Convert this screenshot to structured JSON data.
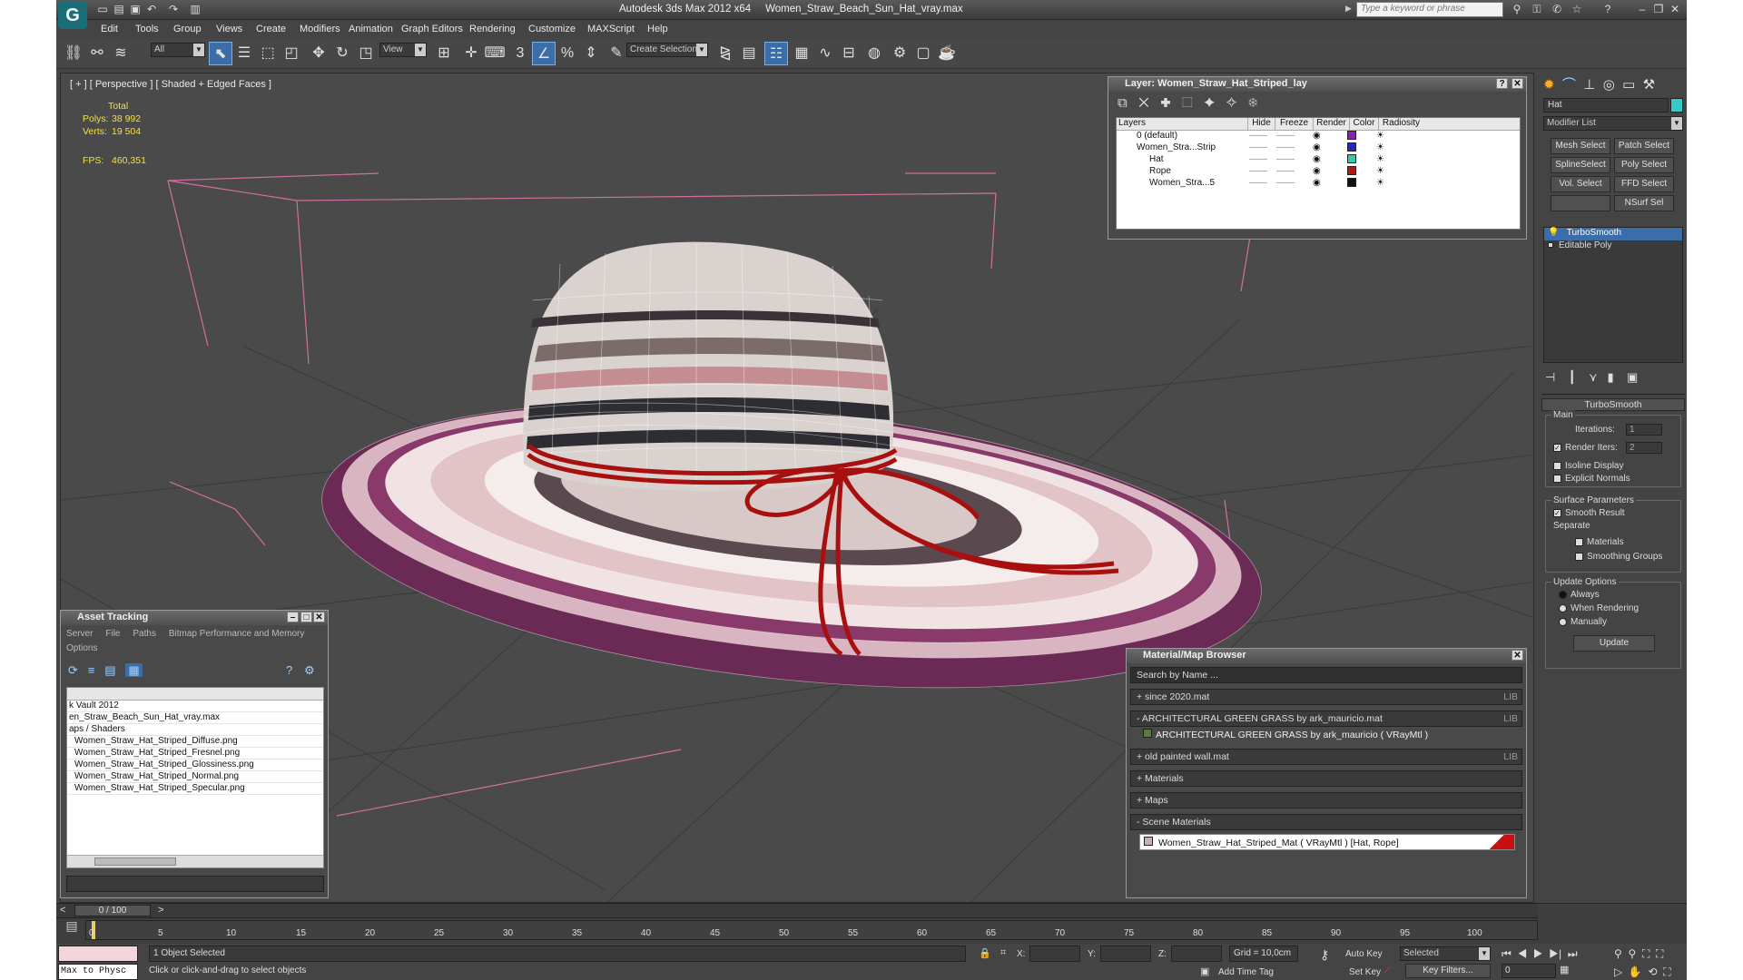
{
  "app": {
    "title": "Autodesk 3ds Max 2012 x64",
    "filename": "Women_Straw_Beach_Sun_Hat_vray.max",
    "search_placeholder": "Type a keyword or phrase"
  },
  "menus": [
    "Edit",
    "Tools",
    "Group",
    "Views",
    "Create",
    "Modifiers",
    "Animation",
    "Graph Editors",
    "Rendering",
    "Customize",
    "MAXScript",
    "Help"
  ],
  "toolbar": {
    "selection_filter": "All",
    "ref_coord": "View",
    "snap_label": "3",
    "named_selection": "Create Selection Se"
  },
  "viewport": {
    "label": "[ + ] [ Perspective ] [ Shaded + Edged Faces ]",
    "stats": {
      "total_label": "Total",
      "polys_label": "Polys:",
      "polys": "38 992",
      "verts_label": "Verts:",
      "verts": "19 504",
      "fps_label": "FPS:",
      "fps": "460,351"
    }
  },
  "layer_panel": {
    "title": "Layer: Women_Straw_Hat_Striped_lay",
    "columns": [
      "Layers",
      "Hide",
      "Freeze",
      "Render",
      "Color",
      "Radiosity"
    ],
    "rows": [
      {
        "name": "0 (default)",
        "color": "#8a1fb0"
      },
      {
        "name": "Women_Stra...Strip",
        "color": "#2525c0"
      },
      {
        "name": "Hat",
        "color": "#38c8a8"
      },
      {
        "name": "Rope",
        "color": "#b01818"
      },
      {
        "name": "Women_Stra...5",
        "color": "#111111"
      }
    ]
  },
  "asset_tracking": {
    "title": "Asset Tracking",
    "menus": [
      "Server",
      "File",
      "Paths",
      "Bitmap Performance and Memory",
      "Options"
    ],
    "items": [
      "k Vault 2012",
      "en_Straw_Beach_Sun_Hat_vray.max",
      "aps / Shaders",
      "Women_Straw_Hat_Striped_Diffuse.png",
      "Women_Straw_Hat_Striped_Fresnel.png",
      "Women_Straw_Hat_Striped_Glossiness.png",
      "Women_Straw_Hat_Striped_Normal.png",
      "Women_Straw_Hat_Striped_Specular.png"
    ]
  },
  "material_browser": {
    "title": "Material/Map Browser",
    "search_placeholder": "Search by Name ...",
    "groups": [
      {
        "label": "+ since 2020.mat",
        "lib": "LIB"
      },
      {
        "label": "- ARCHITECTURAL GREEN GRASS by ark_mauricio.mat",
        "lib": "LIB"
      },
      {
        "label": "ARCHITECTURAL GREEN GRASS by ark_mauricio  ( VRayMtl )",
        "lib": ""
      },
      {
        "label": "+ old painted wall.mat",
        "lib": "LIB"
      },
      {
        "label": "+ Materials",
        "lib": ""
      },
      {
        "label": "+ Maps",
        "lib": ""
      },
      {
        "label": "- Scene Materials",
        "lib": ""
      }
    ],
    "scene_material": "Women_Straw_Hat_Striped_Mat  ( VRayMtl ) [Hat, Rope]"
  },
  "command_panel": {
    "object_name": "Hat",
    "modifier_list": "Modifier List",
    "buttons": [
      "Mesh Select",
      "Patch Select",
      "SplineSelect",
      "Poly Select",
      "Vol. Select",
      "FFD Select",
      "",
      "NSurf Sel"
    ],
    "stack": [
      "TurboSmooth",
      "Editable Poly"
    ],
    "turbosmooth": {
      "title": "TurboSmooth",
      "main": "Main",
      "iterations_label": "Iterations:",
      "iterations": "1",
      "render_iters_label": "Render Iters:",
      "render_iters": "2",
      "isoline": "Isoline Display",
      "explicit": "Explicit Normals",
      "surface_params": "Surface Parameters",
      "smooth_result": "Smooth Result",
      "separate": "Separate",
      "materials": "Materials",
      "smoothing_groups": "Smoothing Groups",
      "update_options": "Update Options",
      "always": "Always",
      "when_rendering": "When Rendering",
      "manually": "Manually",
      "update": "Update"
    }
  },
  "timeline": {
    "frame": "0 / 100",
    "ticks": [
      "0",
      "5",
      "10",
      "15",
      "20",
      "25",
      "30",
      "35",
      "40",
      "45",
      "50",
      "55",
      "60",
      "65",
      "70",
      "75",
      "80",
      "85",
      "90",
      "95",
      "100"
    ]
  },
  "status": {
    "script_label": "Max to Physc",
    "selected": "1 Object Selected",
    "prompt": "Click or click-and-drag to select objects",
    "x_label": "X:",
    "y_label": "Y:",
    "z_label": "Z:",
    "grid": "Grid = 10,0cm",
    "add_time_tag": "Add Time Tag",
    "auto_key": "Auto Key",
    "set_key": "Set Key",
    "selected_dd": "Selected",
    "key_filters": "Key Filters...",
    "frame_field": "0"
  },
  "colors": {
    "accent": "#3b6ea8",
    "rope": "#a81010",
    "grid_pink": "#d070a0",
    "stats_yellow": "#f4e040"
  }
}
